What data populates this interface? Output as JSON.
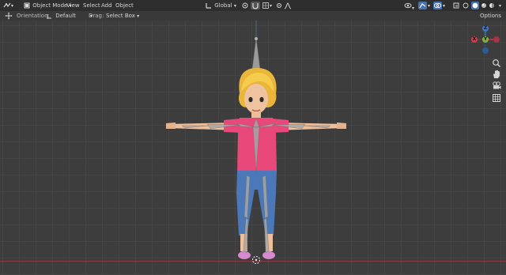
{
  "header": {
    "mode_label": "Object Mode",
    "menus": [
      "View",
      "Select",
      "Add",
      "Object"
    ],
    "transform_orientation": "Global"
  },
  "toolbar": {
    "orientation_label": "Orientation:",
    "orientation_value": "Default",
    "drag_label": "Drag:",
    "drag_value": "Select Box",
    "options_label": "Options"
  },
  "gizmo": {
    "axes": [
      "Z",
      "Y",
      "X"
    ],
    "colors": {
      "x": "#d23c4b",
      "y": "#7fb33d",
      "z": "#3a76cd"
    }
  },
  "colors": {
    "accent": "#4772b3",
    "x_axis_line": "#8a3b46",
    "y_axis_line": "#5c8a2a",
    "shirt": "#e8497a",
    "jeans": "#4a78b8",
    "hair": "#f2c84b",
    "skin": "#f1c7a4",
    "bones": "#a0a0a0"
  }
}
